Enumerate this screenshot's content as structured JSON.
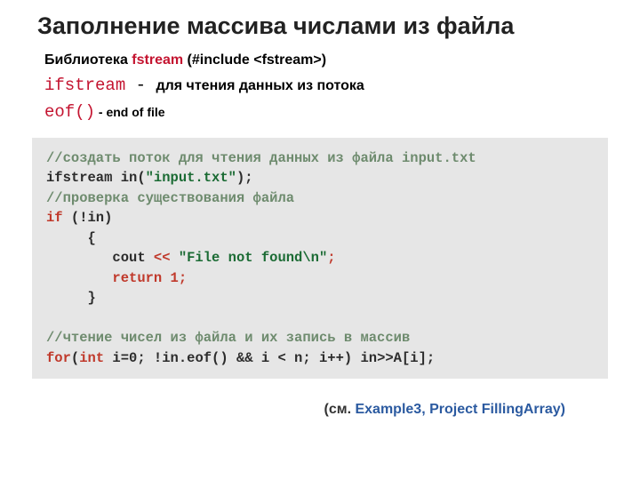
{
  "title": "Заполнение массива числами из файла",
  "lib": {
    "lead": "Библиотека ",
    "name": "fstream",
    "inc": "   (#include <fstream>)"
  },
  "ifs": {
    "name": "ifstream",
    "dash": "   -   ",
    "desc": "для чтения данных из потока"
  },
  "eof": {
    "name": "eof()",
    "desc": " - end of file"
  },
  "code": {
    "c1": "//создать поток для чтения данных из файла input.txt",
    "l2a": "ifstream in(",
    "l2b": "\"input.txt\"",
    "l2c": ");",
    "c3": "//проверка существования файла",
    "l4a": "if ",
    "l4b": "(!in)",
    "l5": "     {",
    "l6a": "        cout ",
    "l6b": "<< ",
    "l6c": "\"File not found\\n\"",
    "l6d": ";",
    "l7a": "        return ",
    "l7b": "1;",
    "l8": "     }",
    "c9": "//чтение чисел из файла и их запись в массив",
    "l10a": "for",
    "l10b": "(",
    "l10c": "int",
    "l10d": " i=0; !in.eof() && i < n; i++) in>>A[i];"
  },
  "footer": {
    "a": "(см.",
    "b": " Example3, Project FillingArray)"
  }
}
